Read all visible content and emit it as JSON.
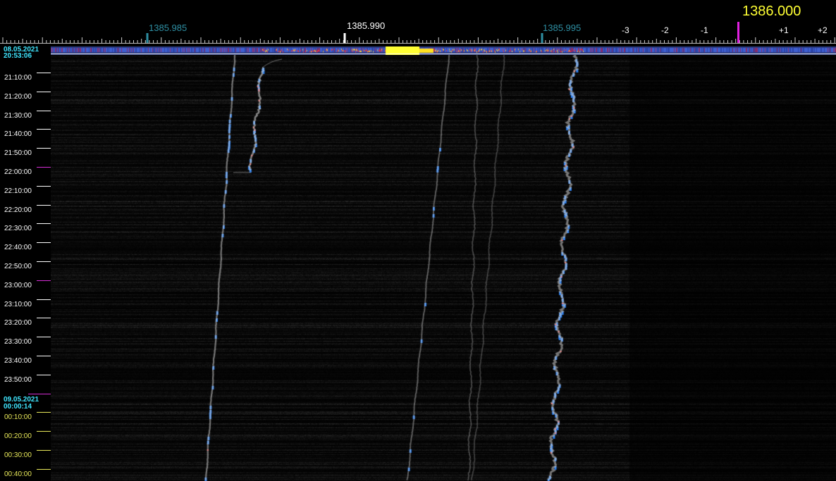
{
  "app": {
    "name": "spectrum waterfall"
  },
  "frequency_scale": {
    "readout": "1386.000",
    "major_labels": [
      {
        "text": "1385.985",
        "color": "#2e8fa3"
      },
      {
        "text": "1385.990",
        "color": "#ffffff"
      },
      {
        "text": "1385.995",
        "color": "#2e8fa3"
      }
    ],
    "offset_labels": [
      "-3",
      "-2",
      "-1",
      "+1",
      "+2"
    ]
  },
  "date_stamps": [
    {
      "date": "08.05.2021",
      "time": "20:53:06"
    },
    {
      "date": "09.05.2021",
      "time": "00:00:14"
    }
  ],
  "time_labels": [
    "21:10:00",
    "21:20:00",
    "21:30:00",
    "21:40:00",
    "21:50:00",
    "22:00:00",
    "22:10:00",
    "22:20:00",
    "22:30:00",
    "22:40:00",
    "22:50:00",
    "23:00:00",
    "23:10:00",
    "23:20:00",
    "23:30:00",
    "23:40:00",
    "23:50:00",
    "00:10:00",
    "00:20:00",
    "00:30:00",
    "00:40:00"
  ],
  "colors": {
    "background": "#000000",
    "tick_white": "#ffffff",
    "tick_yellow": "#e8e85a",
    "tick_magenta": "#d62ed6",
    "label_teal": "#2e8fa3",
    "accent_yellow": "#ffff33",
    "date_cyan": "#3fe6ff",
    "signal_blue": "#2a7ff0",
    "signal_red": "#ff3030",
    "marker_magenta": "#e020e0"
  }
}
